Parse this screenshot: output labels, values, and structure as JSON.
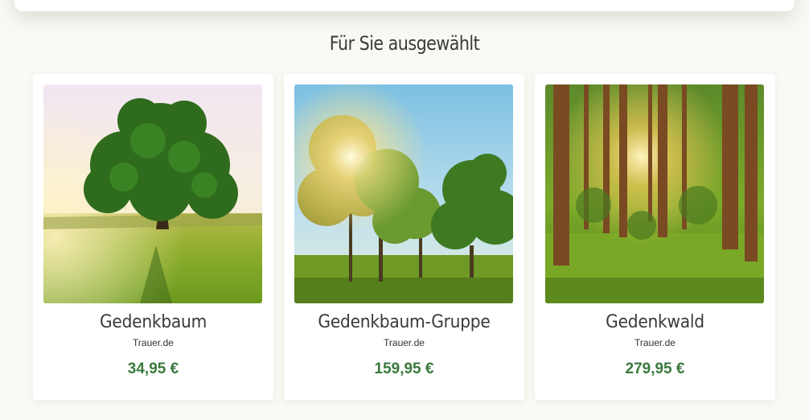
{
  "section": {
    "title": "Für Sie ausgewählt"
  },
  "products": [
    {
      "name": "Gedenkbaum",
      "vendor": "Trauer.de",
      "price": "34,95 €",
      "image": "single-tree-meadow-image"
    },
    {
      "name": "Gedenkbaum-Gruppe",
      "vendor": "Trauer.de",
      "price": "159,95 €",
      "image": "tree-group-sun-image"
    },
    {
      "name": "Gedenkwald",
      "vendor": "Trauer.de",
      "price": "279,95 €",
      "image": "forest-sunlight-image"
    }
  ],
  "colors": {
    "background": "#fbf9f4",
    "card": "#ffffff",
    "price": "#3a7a3e",
    "text": "#3a3a3a"
  }
}
